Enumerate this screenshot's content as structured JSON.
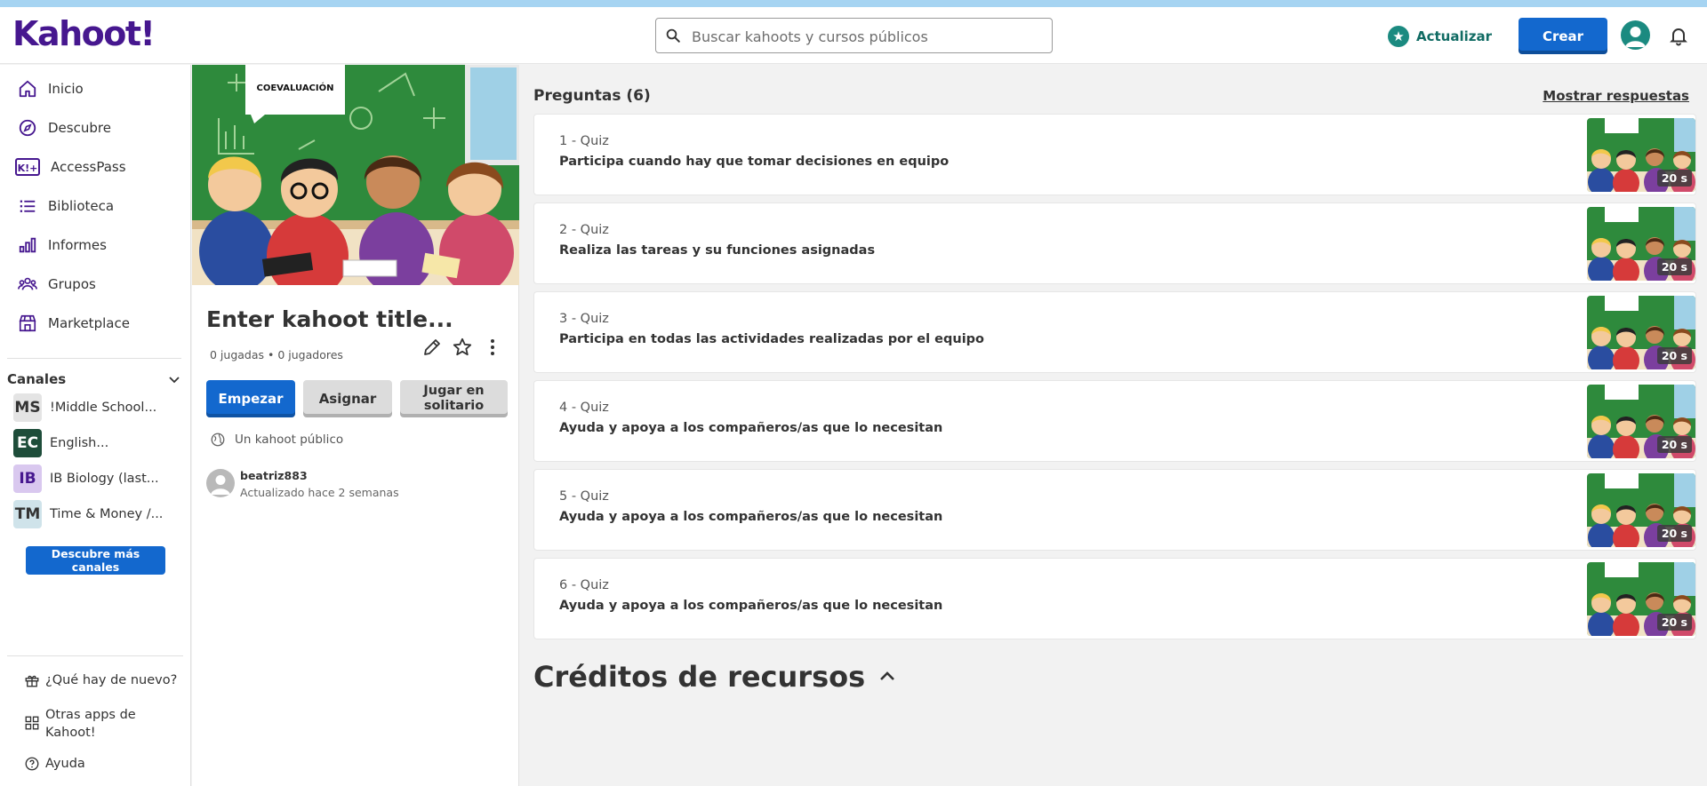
{
  "topbar": {
    "logo": "Kahoot!",
    "search_placeholder": "Buscar kahoots y cursos públicos",
    "upgrade_label": "Actualizar",
    "create_label": "Crear"
  },
  "sidebar": {
    "items": [
      {
        "label": "Inicio",
        "icon": "home-icon"
      },
      {
        "label": "Descubre",
        "icon": "compass-icon"
      },
      {
        "label": "AccessPass",
        "icon": "accesspass-icon"
      },
      {
        "label": "Biblioteca",
        "icon": "list-icon"
      },
      {
        "label": "Informes",
        "icon": "bar-chart-icon"
      },
      {
        "label": "Grupos",
        "icon": "groups-icon"
      },
      {
        "label": "Marketplace",
        "icon": "store-icon"
      }
    ],
    "channels_title": "Canales",
    "channels": [
      {
        "badge": "MS",
        "label": "!Middle School...",
        "bg": "#e4e4e4",
        "fg": "#333333"
      },
      {
        "badge": "EC",
        "label": "English...",
        "bg": "#1e4d3a",
        "fg": "#ffffff"
      },
      {
        "badge": "IB",
        "label": "IB Biology (last...",
        "bg": "#d9c8ef",
        "fg": "#46178f"
      },
      {
        "badge": "TM",
        "label": "Time & Money /...",
        "bg": "#cfe3ea",
        "fg": "#333333"
      }
    ],
    "more_channels_label": "Descubre más canales",
    "footer": [
      {
        "label": "¿Qué hay de nuevo?",
        "icon": "gift-icon"
      },
      {
        "label": "Otras apps de Kahoot!",
        "icon": "apps-grid-icon"
      },
      {
        "label": "Ayuda",
        "icon": "help-icon"
      }
    ]
  },
  "kahoot": {
    "cover_label": "COEVALUACIÓN",
    "title": "Enter kahoot title...",
    "stats": "0 jugadas • 0 jugadores",
    "start_label": "Empezar",
    "assign_label": "Asignar",
    "solo_label": "Jugar en solitario",
    "visibility": "Un kahoot público",
    "author": "beatriz883",
    "updated": "Actualizado hace 2 semanas"
  },
  "questions": {
    "title": "Preguntas (6)",
    "show_answers": "Mostrar respuestas",
    "items": [
      {
        "type": "1 - Quiz",
        "text": "Participa cuando hay que tomar decisiones en equipo",
        "time": "20 s"
      },
      {
        "type": "2 - Quiz",
        "text": "Realiza las tareas y su funciones asignadas",
        "time": "20 s"
      },
      {
        "type": "3 - Quiz",
        "text": "Participa en todas las actividades realizadas por el equipo",
        "time": "20 s"
      },
      {
        "type": "4 - Quiz",
        "text": "Ayuda y apoya a los compañeros/as que lo necesitan",
        "time": "20 s"
      },
      {
        "type": "5 - Quiz",
        "text": "Ayuda y apoya a los compañeros/as que lo necesitan",
        "time": "20 s"
      },
      {
        "type": "6 - Quiz",
        "text": "Ayuda y apoya a los compañeros/as que lo necesitan",
        "time": "20 s"
      }
    ]
  },
  "credits_title": "Créditos de recursos",
  "colors": {
    "brand_purple": "#46178f",
    "primary_blue": "#1368ce",
    "teal": "#1b8a80"
  }
}
